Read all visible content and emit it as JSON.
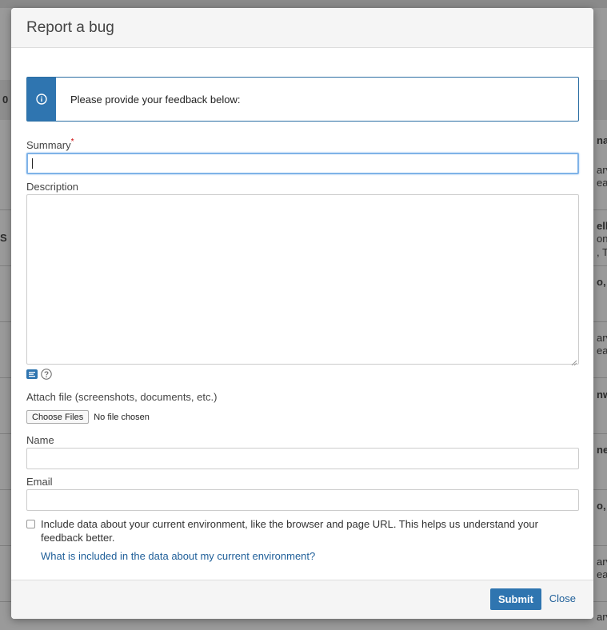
{
  "background": {
    "fragments": {
      "f1": "0",
      "f2": "nat",
      "f3": "arv",
      "f4": "ea",
      "f5": "S",
      "f6": "ell",
      "f7": "ong",
      "f8": ", TX",
      "f9": "o, T",
      "f10": "arv",
      "f11": "ea",
      "f12": "nw",
      "f13": "nea",
      "f14": "o, T",
      "f15": "arv",
      "f16": "ea",
      "f17": "arv"
    }
  },
  "dialog": {
    "title": "Report a bug",
    "info_message": "Please provide your feedback below:",
    "summary": {
      "label": "Summary",
      "required_marker": "*",
      "value": ""
    },
    "description": {
      "label": "Description",
      "value": ""
    },
    "attach": {
      "label": "Attach file (screenshots, documents, etc.)",
      "button_label": "Choose Files",
      "status": "No file chosen"
    },
    "name": {
      "label": "Name",
      "value": ""
    },
    "email": {
      "label": "Email",
      "value": ""
    },
    "environment": {
      "checked": false,
      "text": "Include data about your current environment, like the browser and page URL. This helps us understand your feedback better.",
      "link": "What is included in the data about my current environment?"
    },
    "footer": {
      "submit_label": "Submit",
      "close_label": "Close"
    }
  },
  "colors": {
    "accent": "#2f75b0",
    "link": "#1f5f99",
    "focus": "#7fb3e8",
    "required": "#cc0000"
  }
}
